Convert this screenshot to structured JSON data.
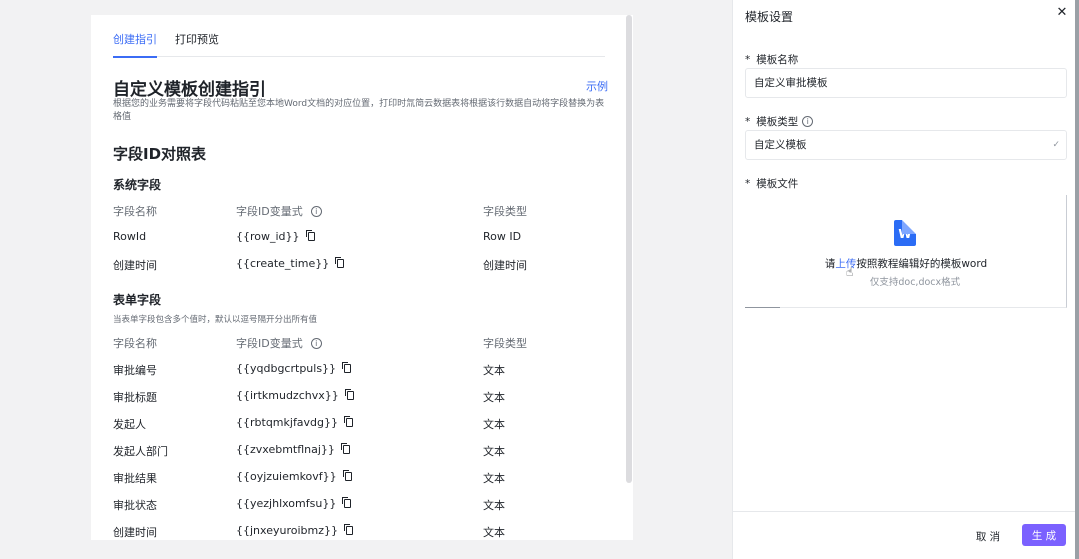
{
  "guide": {
    "tabs": [
      {
        "label": "创建指引",
        "active": true
      },
      {
        "label": "打印预览",
        "active": false
      }
    ],
    "title": "自定义模板创建指引",
    "example_link": "示例",
    "description": "根据您的业务需要将字段代码粘贴至您本地Word文档的对应位置，打印时氚简云数据表将根据该行数据自动将字段替换为表格值",
    "mapping_title": "字段ID对照表",
    "system_section": {
      "title": "系统字段",
      "headers": [
        "字段名称",
        "字段ID变量式",
        "字段类型"
      ],
      "rows": [
        {
          "name": "RowId",
          "code": "{{row_id}}",
          "type": "Row ID"
        },
        {
          "name": "创建时间",
          "code": "{{create_time}}",
          "type": "创建时间"
        }
      ]
    },
    "form_section": {
      "title": "表单字段",
      "note": "当表单字段包含多个值时，默认以逗号隔开分出所有值",
      "headers": [
        "字段名称",
        "字段ID变量式",
        "字段类型"
      ],
      "rows": [
        {
          "name": "审批编号",
          "code": "{{yqdbgcrtpuls}}",
          "type": "文本"
        },
        {
          "name": "审批标题",
          "code": "{{irtkmudzchvx}}",
          "type": "文本"
        },
        {
          "name": "发起人",
          "code": "{{rbtqmkjfavdg}}",
          "type": "文本"
        },
        {
          "name": "发起人部门",
          "code": "{{zvxebmtflnaj}}",
          "type": "文本"
        },
        {
          "name": "审批结果",
          "code": "{{oyjzuiemkovf}}",
          "type": "文本"
        },
        {
          "name": "审批状态",
          "code": "{{yezjhlxomfsu}}",
          "type": "文本"
        },
        {
          "name": "创建时间",
          "code": "{{jnxeyuroibmz}}",
          "type": "文本"
        }
      ]
    }
  },
  "drawer": {
    "title": "模板设置",
    "fields": {
      "name_label": "模板名称",
      "name_value": "自定义审批模板",
      "type_label": "模板类型",
      "type_value": "自定义模板",
      "file_label": "模板文件"
    },
    "upload": {
      "prefix": "请",
      "link": "上传",
      "suffix": "按照教程编辑好的模板word",
      "hint": "仅支持doc,docx格式",
      "icon_letter": "W"
    },
    "footer": {
      "cancel_label": "取 消",
      "generate_label": "生 成"
    }
  },
  "colors": {
    "accent": "#3b6cf5",
    "primary_button": "#7b61ff",
    "word_icon": "#2b6cf5"
  }
}
